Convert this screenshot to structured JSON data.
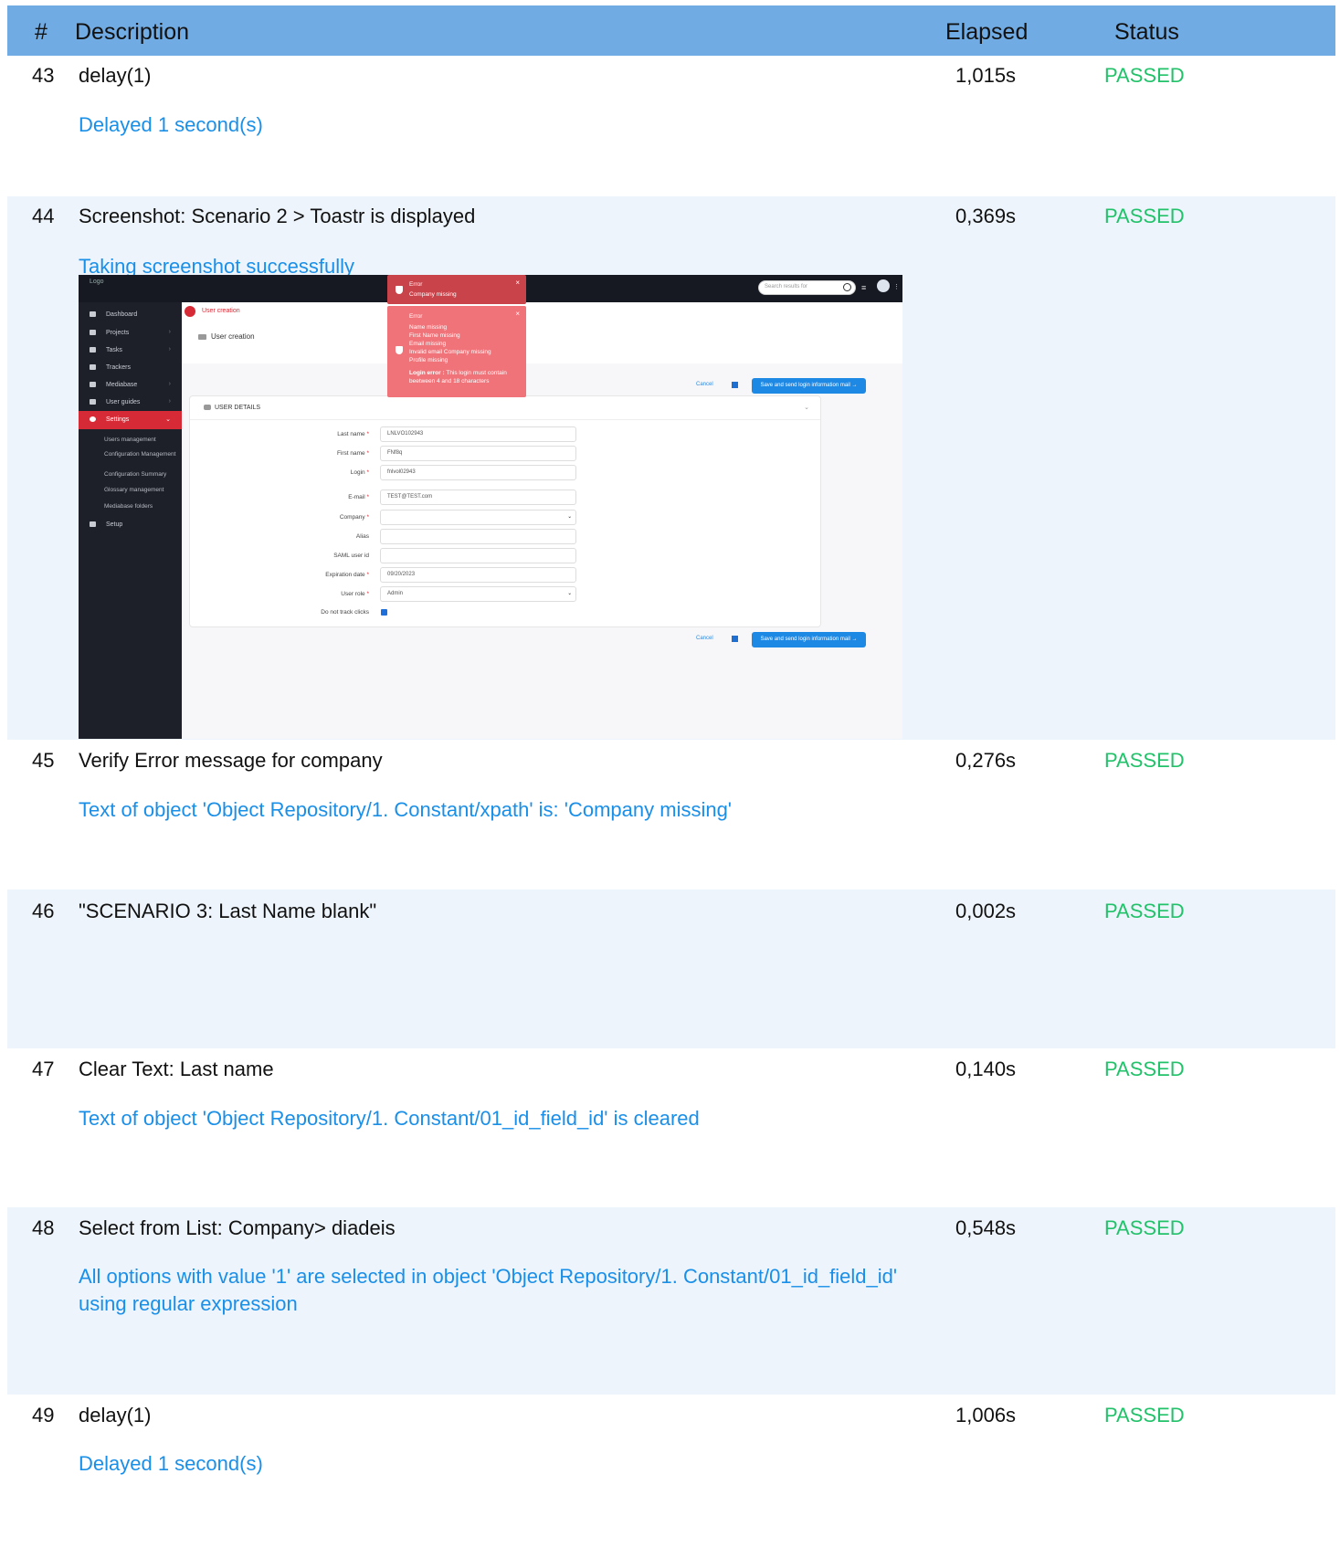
{
  "header": {
    "num": "#",
    "description": "Description",
    "elapsed": "Elapsed",
    "status": "Status"
  },
  "rows": [
    {
      "num": "43",
      "description": "delay(1)",
      "elapsed": "1,015s",
      "status": "PASSED",
      "message": "Delayed 1 second(s)"
    },
    {
      "num": "44",
      "description": "Screenshot: Scenario 2  > Toastr is displayed",
      "elapsed": "0,369s",
      "status": "PASSED",
      "message": "Taking screenshot successfully"
    },
    {
      "num": "45",
      "description": "Verify Error message for company",
      "elapsed": "0,276s",
      "status": "PASSED",
      "message": "Text of object 'Object Repository/1. Constant/xpath' is: 'Company missing'"
    },
    {
      "num": "46",
      "description": "\"SCENARIO 3: Last Name blank\"",
      "elapsed": "0,002s",
      "status": "PASSED",
      "message": ""
    },
    {
      "num": "47",
      "description": "Clear Text: Last name",
      "elapsed": "0,140s",
      "status": "PASSED",
      "message": "Text of object 'Object Repository/1. Constant/01_id_field_id' is cleared"
    },
    {
      "num": "48",
      "description": "Select from List: Company> diadeis",
      "elapsed": "0,548s",
      "status": "PASSED",
      "message": "All options with value '1' are selected in object 'Object Repository/1. Constant/01_id_field_id' using regular expression"
    },
    {
      "num": "49",
      "description": "delay(1)",
      "elapsed": "1,006s",
      "status": "PASSED",
      "message": "Delayed 1 second(s)"
    }
  ],
  "screenshot": {
    "logo_alt": "Logo",
    "sidebar": {
      "items": [
        "Dashboard",
        "Projects",
        "Tasks",
        "Trackers",
        "Mediabase",
        "User guides",
        "Settings",
        "Setup"
      ],
      "subitems": [
        "Users management",
        "Configuration Management",
        "Configuration Summary",
        "Glossary management",
        "Mediabase folders"
      ]
    },
    "search_placeholder": "Search results for",
    "breadcrumb": "User creation",
    "page_title": "User creation",
    "cancel_label": "Cancel",
    "save_label": "Save and send login information mail →",
    "card_title": "USER DETAILS",
    "fields": [
      {
        "label": "Last name",
        "required": "*",
        "value": "LNLVO102943"
      },
      {
        "label": "First name",
        "required": "*",
        "value": "FNf8q"
      },
      {
        "label": "Login",
        "required": "*",
        "value": "fnlvol02943"
      },
      {
        "label": "E-mail",
        "required": "*",
        "value": "TEST@TEST.com"
      },
      {
        "label": "Company",
        "required": "*",
        "value": ""
      },
      {
        "label": "Alias",
        "required": "",
        "value": ""
      },
      {
        "label": "SAML user id",
        "required": "",
        "value": ""
      },
      {
        "label": "Expiration date",
        "required": "*",
        "value": "09/20/2023"
      },
      {
        "label": "User role",
        "required": "*",
        "value": "Admin"
      }
    ],
    "checkbox_label": "Do not track clicks",
    "toast1": {
      "title": "Error",
      "text": "Company missing"
    },
    "toast2": {
      "title": "Error",
      "lines": [
        "Name missing",
        "First Name missing",
        "Email missing",
        "Invalid email Company missing",
        "Profile missing"
      ],
      "login_error_label": "Login error :",
      "login_error_text": "This login must contain beetween 4 and 18 characters"
    },
    "colors": {
      "accent": "#1e88e5",
      "danger": "#d62b36",
      "toast": "#f07379"
    }
  }
}
